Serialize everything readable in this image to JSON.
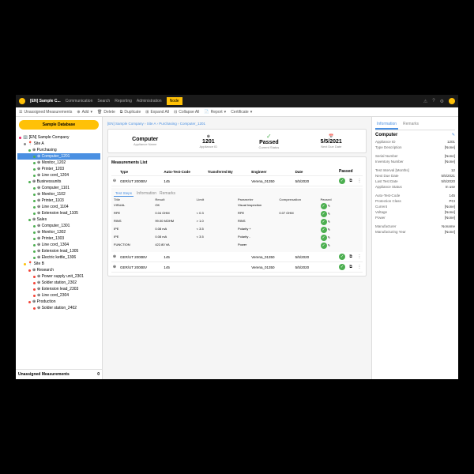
{
  "topbar": {
    "app": "[EN] Sample C...",
    "nav": [
      "Communication",
      "Search",
      "Reporting",
      "Administration",
      "Node"
    ],
    "active": 4
  },
  "toolbar": {
    "unassigned": "Unassigned Measurements",
    "add": "Add",
    "delete": "Delete",
    "duplicate": "Duplicate",
    "expand": "Expand All",
    "collapse": "Collapse All",
    "report": "Report",
    "cert": "Certificate"
  },
  "sidebar": {
    "db": "Sample Database",
    "unassigned": {
      "label": "Unassigned Measurements",
      "count": "0"
    },
    "tree": [
      {
        "label": "[EN] Sample Company",
        "ind": 0,
        "color": "#e91e63",
        "icon": "🏢"
      },
      {
        "label": "Site A",
        "ind": 1,
        "color": "#888",
        "icon": "📍"
      },
      {
        "label": "Purchasing",
        "ind": 2,
        "color": "#4caf50"
      },
      {
        "label": "Computer_1201",
        "ind": 3,
        "color": "#4caf50",
        "sel": true
      },
      {
        "label": "Monitor_1202",
        "ind": 3,
        "color": "#4caf50"
      },
      {
        "label": "Printer_1203",
        "ind": 3,
        "color": "#4caf50"
      },
      {
        "label": "Line cord_1204",
        "ind": 3,
        "color": "#4caf50"
      },
      {
        "label": "Businessunits",
        "ind": 2,
        "color": "#4caf50"
      },
      {
        "label": "Computer_1101",
        "ind": 3,
        "color": "#4caf50"
      },
      {
        "label": "Monitor_1102",
        "ind": 3,
        "color": "#4caf50"
      },
      {
        "label": "Printer_1103",
        "ind": 3,
        "color": "#4caf50"
      },
      {
        "label": "Line cord_1104",
        "ind": 3,
        "color": "#4caf50"
      },
      {
        "label": "Extension lead_1105",
        "ind": 3,
        "color": "#4caf50"
      },
      {
        "label": "Sales",
        "ind": 2,
        "color": "#4caf50"
      },
      {
        "label": "Computer_1301",
        "ind": 3,
        "color": "#4caf50"
      },
      {
        "label": "Monitor_1302",
        "ind": 3,
        "color": "#4caf50"
      },
      {
        "label": "Printer_1303",
        "ind": 3,
        "color": "#4caf50"
      },
      {
        "label": "Line cord_1304",
        "ind": 3,
        "color": "#4caf50"
      },
      {
        "label": "Extension lead_1305",
        "ind": 3,
        "color": "#4caf50"
      },
      {
        "label": "Electric kettle_1306",
        "ind": 3,
        "color": "#4caf50"
      },
      {
        "label": "Site B",
        "ind": 1,
        "color": "#ffc107",
        "icon": "📍"
      },
      {
        "label": "Research",
        "ind": 2,
        "color": "#f44336"
      },
      {
        "label": "Power supply unit_2301",
        "ind": 3,
        "color": "#f44336"
      },
      {
        "label": "Solder station_2302",
        "ind": 3,
        "color": "#f44336"
      },
      {
        "label": "Extension lead_2303",
        "ind": 3,
        "color": "#f44336"
      },
      {
        "label": "Line cord_2304",
        "ind": 3,
        "color": "#f44336"
      },
      {
        "label": "Production",
        "ind": 2,
        "color": "#f44336"
      },
      {
        "label": "Solder station_2402",
        "ind": 3,
        "color": "#f44336"
      }
    ]
  },
  "crumbs": "[EN] Sample Company  ›  Site A  ›  Purchasing  ›  Computer_1201",
  "status": {
    "name": {
      "big": "Computer",
      "sub": "Appliance Name"
    },
    "id": {
      "big": "1201",
      "sub": "Appliance ID"
    },
    "pass": {
      "big": "Passed",
      "sub": "Current Status"
    },
    "due": {
      "big": "5/5/2021",
      "sub": "Next Due Date"
    }
  },
  "measurements": {
    "title": "Measurements List",
    "headers": [
      "Type",
      "Auto-Test-Code",
      "Transferred By",
      "Engineer",
      "Date",
      "Passed"
    ],
    "rows": [
      {
        "type": "GER/UT 2000BV",
        "code": "145",
        "eng": "Verena_01350",
        "date": "5/5/2020",
        "expanded": true
      },
      {
        "type": "GER/UT 2000BV",
        "code": "145",
        "eng": "Verena_01350",
        "date": "5/5/2020"
      },
      {
        "type": "GER/UT 2000BV",
        "code": "145",
        "eng": "Verena_01350",
        "date": "5/5/2020"
      }
    ],
    "stepTabs": [
      "Test Steps",
      "Information",
      "Remarks"
    ],
    "stepHdr": [
      "Title",
      "Result",
      "Limit",
      "Parameter",
      "Compensation",
      "Passed"
    ],
    "steps": [
      {
        "t": "VISUAL",
        "r": "OK",
        "l": "",
        "p": "Visual Inspection",
        "c": "",
        "pass": true
      },
      {
        "t": "RPE",
        "r": "0.04 OHM",
        "l": "< 0.3",
        "p": "RPE",
        "c": "0.07 OHM",
        "pass": true
      },
      {
        "t": "RINS",
        "r": "99.00 MOHM",
        "l": "> 1.0",
        "p": "RINS",
        "c": "",
        "pass": true
      },
      {
        "t": "IPE",
        "r": "0.08 mA",
        "l": "< 3.5",
        "p": "Polarity +",
        "c": "",
        "pass": true
      },
      {
        "t": "IPE",
        "r": "0.08 mA",
        "l": "< 3.5",
        "p": "Polarity -",
        "c": "",
        "pass": true
      },
      {
        "t": "FUNCTION",
        "r": "422.80 VA",
        "l": "",
        "p": "Power",
        "c": "",
        "pass": true
      }
    ]
  },
  "info": {
    "tabs": [
      "Information",
      "Remarks"
    ],
    "title": "Computer",
    "fields": [
      {
        "lbl": "Appliance ID",
        "val": "1201"
      },
      {
        "lbl": "Type Description",
        "val": "[None]"
      },
      {
        "lbl": "Serial Number",
        "val": "[None]"
      },
      {
        "lbl": "Inventory Number",
        "val": "[None]"
      },
      {
        "lbl": "Test Interval [Months]",
        "val": "12"
      },
      {
        "lbl": "Next Due Date",
        "val": "5/5/2021"
      },
      {
        "lbl": "Last Test Date",
        "val": "5/5/2020"
      },
      {
        "lbl": "Appliance Status",
        "val": "In use"
      },
      {
        "lbl": "Auto-Test-Code",
        "val": "145"
      },
      {
        "lbl": "Protection Class",
        "val": "PCI"
      },
      {
        "lbl": "Current",
        "val": "[None]"
      },
      {
        "lbl": "Voltage",
        "val": "[None]"
      },
      {
        "lbl": "Power",
        "val": "[None]"
      },
      {
        "lbl": "Manufacturer",
        "val": "Noname"
      },
      {
        "lbl": "Manufacturing Year",
        "val": "[None]"
      }
    ]
  }
}
